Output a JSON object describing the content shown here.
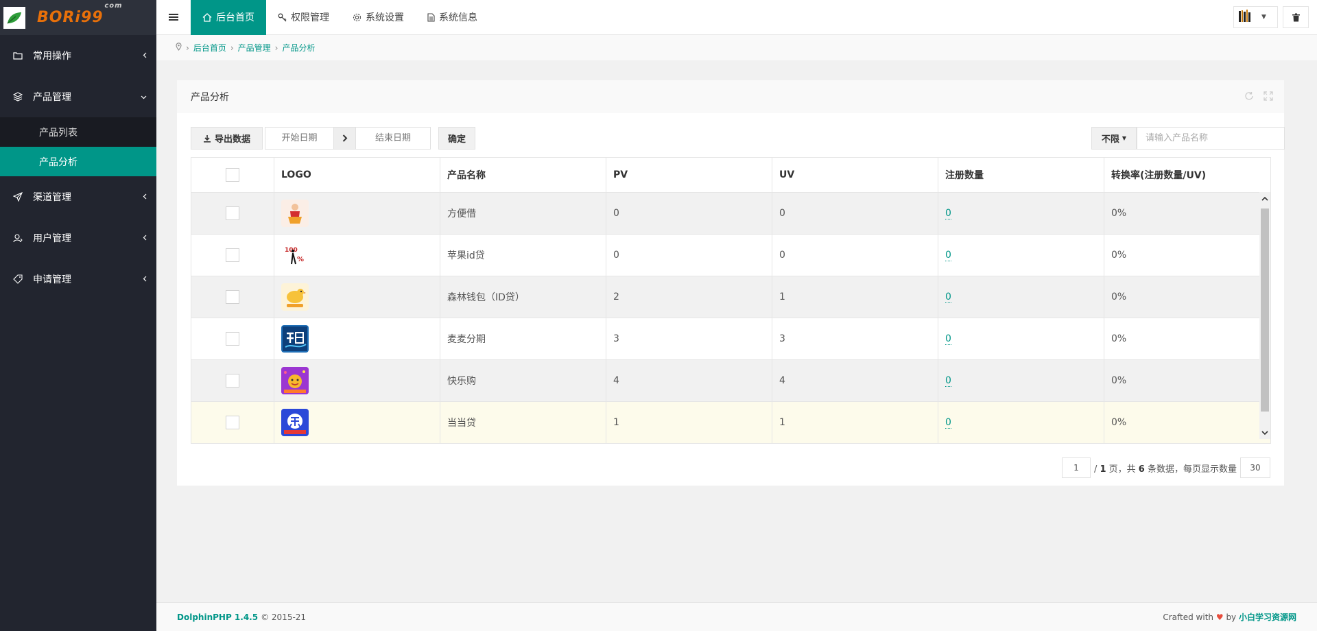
{
  "logo": {
    "text": "BORi99",
    "suffix": "com"
  },
  "sidebar": {
    "items": [
      {
        "label": "常用操作",
        "icon": "folder-icon"
      },
      {
        "label": "产品管理",
        "icon": "layers-icon"
      },
      {
        "label": "渠道管理",
        "icon": "send-icon"
      },
      {
        "label": "用户管理",
        "icon": "user-icon"
      },
      {
        "label": "申请管理",
        "icon": "tag-icon"
      }
    ],
    "sub_items": [
      {
        "label": "产品列表"
      },
      {
        "label": "产品分析"
      }
    ]
  },
  "topbar": {
    "tabs": [
      {
        "label": "后台首页"
      },
      {
        "label": "权限管理"
      },
      {
        "label": "系统设置"
      },
      {
        "label": "系统信息"
      }
    ]
  },
  "breadcrumb": [
    "后台首页",
    "产品管理",
    "产品分析"
  ],
  "card": {
    "title": "产品分析",
    "export_label": "导出数据",
    "start_placeholder": "开始日期",
    "end_placeholder": "结束日期",
    "confirm_label": "确定",
    "filter_label": "不限",
    "search_placeholder": "请输入产品名称"
  },
  "table": {
    "headers": [
      "LOGO",
      "产品名称",
      "PV",
      "UV",
      "注册数量",
      "转换率(注册数量/UV)"
    ],
    "rows": [
      {
        "name": "方便借",
        "pv": "0",
        "uv": "0",
        "reg": "0",
        "rate": "0%",
        "logo_color": "#fbeee6"
      },
      {
        "name": "苹果id贷",
        "pv": "0",
        "uv": "0",
        "reg": "0",
        "rate": "0%",
        "logo_color": "#ffffff"
      },
      {
        "name": "森林钱包（ID贷）",
        "pv": "2",
        "uv": "1",
        "reg": "0",
        "rate": "0%",
        "logo_color": "#fdf3d8"
      },
      {
        "name": "麦麦分期",
        "pv": "3",
        "uv": "3",
        "reg": "0",
        "rate": "0%",
        "logo_color": "#1f6fb6"
      },
      {
        "name": "快乐购",
        "pv": "4",
        "uv": "4",
        "reg": "0",
        "rate": "0%",
        "logo_color": "#a83fd6"
      },
      {
        "name": "当当贷",
        "pv": "1",
        "uv": "1",
        "reg": "0",
        "rate": "0%",
        "logo_color": "#2b48d8"
      }
    ]
  },
  "pager": {
    "page": "1",
    "total_pages": "1",
    "text_page": "页，共",
    "total": "6",
    "text_data": "条数据，每页显示数量",
    "per_page": "30"
  },
  "footer": {
    "brand": "DolphinPHP 1.4.5",
    "copyright": "© 2015-21",
    "crafted": "Crafted with",
    "by": "by",
    "site": "小白学习资源网"
  }
}
